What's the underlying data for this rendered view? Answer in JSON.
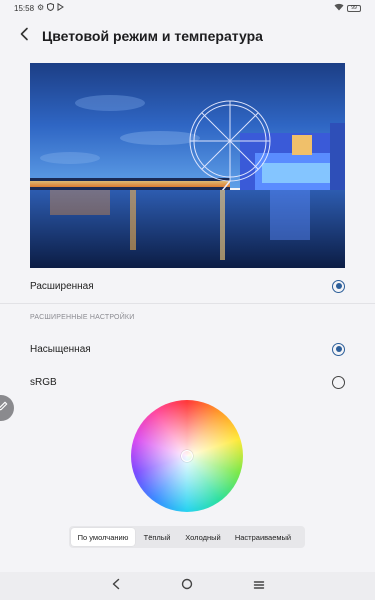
{
  "status_bar": {
    "time": "15:58",
    "battery": "99"
  },
  "header": {
    "title": "Цветовой режим и температура"
  },
  "modes": [
    {
      "label": "Расширенная",
      "selected": true
    }
  ],
  "advanced": {
    "section_title": "РАСШИРЕННЫЕ НАСТРОЙКИ",
    "options": [
      {
        "label": "Насыщенная",
        "selected": true
      },
      {
        "label": "sRGB",
        "selected": false
      }
    ]
  },
  "temperature": {
    "tabs": [
      {
        "label": "По умолчанию",
        "active": true
      },
      {
        "label": "Тёплый",
        "active": false
      },
      {
        "label": "Холодный",
        "active": false
      },
      {
        "label": "Настраиваемый",
        "active": false
      }
    ]
  },
  "colors": {
    "accent": "#2d5f9a",
    "background": "#f4f4f7"
  },
  "icons": {
    "back": "chevron-left-icon",
    "edit": "pencil-icon",
    "nav_back": "triangle-back-icon",
    "nav_home": "circle-home-icon",
    "nav_recents": "menu-lines-icon"
  }
}
